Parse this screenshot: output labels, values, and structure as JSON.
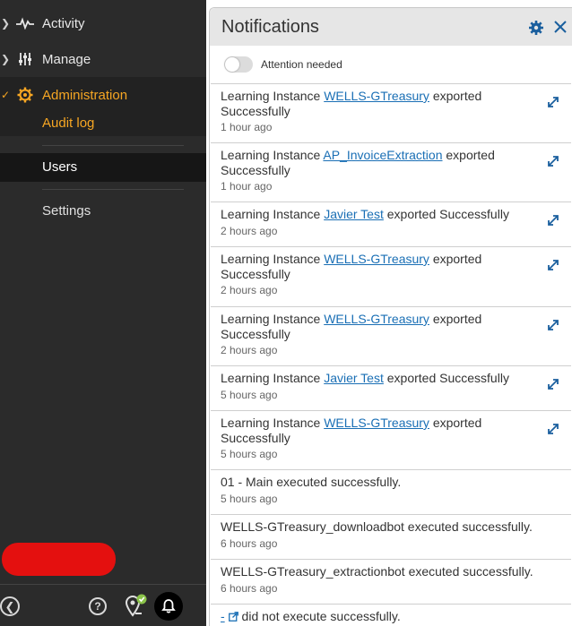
{
  "sidebar": {
    "items": [
      {
        "label": "Activity"
      },
      {
        "label": "Manage"
      },
      {
        "label": "Administration"
      }
    ],
    "submenu": {
      "audit_log": "Audit log",
      "users": "Users",
      "settings": "Settings"
    },
    "accent_color": "#f6a623"
  },
  "panel": {
    "title": "Notifications",
    "toggle_label": "Attention needed",
    "toggle_on": false
  },
  "notifications": [
    {
      "prefix": "Learning Instance ",
      "link": "WELLS-GTreasury",
      "suffix": " exported Successfully",
      "time": "1 hour ago"
    },
    {
      "prefix": "Learning Instance ",
      "link": "AP_InvoiceExtraction",
      "suffix": " exported Successfully",
      "time": "1 hour ago"
    },
    {
      "prefix": "Learning Instance ",
      "link": "Javier Test",
      "suffix": " exported Successfully",
      "time": "2 hours ago"
    },
    {
      "prefix": "Learning Instance ",
      "link": "WELLS-GTreasury",
      "suffix": " exported Successfully",
      "time": "2 hours ago"
    },
    {
      "prefix": "Learning Instance ",
      "link": "WELLS-GTreasury",
      "suffix": " exported Successfully",
      "time": "2 hours ago"
    },
    {
      "prefix": "Learning Instance ",
      "link": "Javier Test",
      "suffix": " exported Successfully",
      "time": "5 hours ago"
    },
    {
      "prefix": "Learning Instance ",
      "link": "WELLS-GTreasury",
      "suffix": " exported Successfully",
      "time": "5 hours ago"
    },
    {
      "text": "01 - Main executed successfully.",
      "time": "5 hours ago"
    },
    {
      "text": "WELLS-GTreasury_downloadbot executed successfully.",
      "time": "6 hours ago"
    },
    {
      "text": "WELLS-GTreasury_extractionbot executed successfully.",
      "time": "6 hours ago"
    },
    {
      "link": "-",
      "suffix": " did not execute successfully."
    }
  ]
}
